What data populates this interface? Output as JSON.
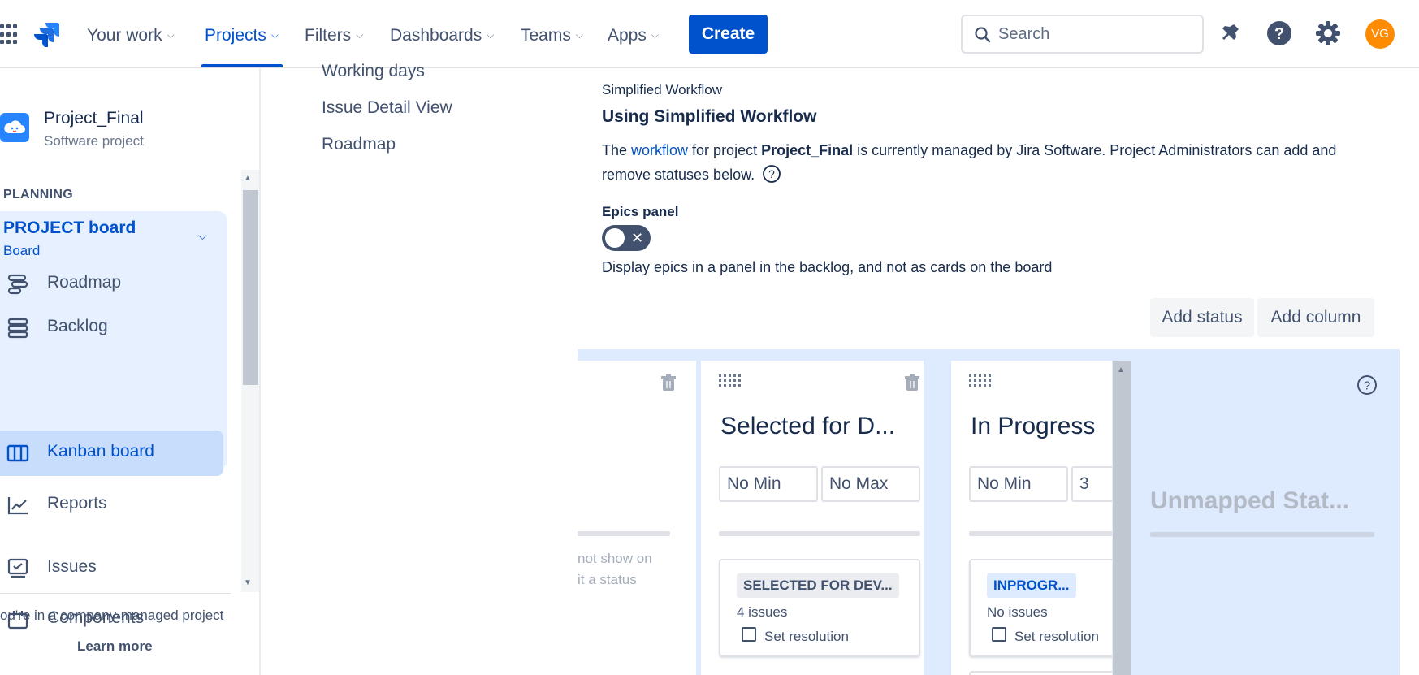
{
  "nav": {
    "items": [
      {
        "label": "Your work"
      },
      {
        "label": "Projects"
      },
      {
        "label": "Filters"
      },
      {
        "label": "Dashboards"
      },
      {
        "label": "Teams"
      },
      {
        "label": "Apps"
      }
    ],
    "create_label": "Create",
    "search_placeholder": "Search",
    "avatar_initials": "VG",
    "accent_color": "#0052cc"
  },
  "sidebar": {
    "project_name": "Project_Final",
    "project_type": "Software project",
    "planning_label": "PLANNING",
    "board_name": "PROJECT board",
    "board_sub": "Board",
    "items": [
      {
        "label": "Roadmap",
        "icon": "roadmap-icon"
      },
      {
        "label": "Backlog",
        "icon": "backlog-icon"
      },
      {
        "label": "Kanban board",
        "icon": "kanban-board-icon"
      },
      {
        "label": "Reports",
        "icon": "reports-icon"
      },
      {
        "label": "Issues",
        "icon": "issues-icon"
      },
      {
        "label": "Components",
        "icon": "components-icon"
      }
    ],
    "company_note": "ou're in a company-managed project",
    "learn_more": "Learn more"
  },
  "settings_nav": {
    "items": [
      {
        "label": "Working days"
      },
      {
        "label": "Issue Detail View"
      },
      {
        "label": "Roadmap"
      }
    ]
  },
  "main": {
    "workflow_section_label": "Simplified Workflow",
    "workflow_heading": "Using Simplified Workflow",
    "workflow_desc_prefix": "The ",
    "workflow_link": "workflow",
    "workflow_desc_mid": " for project ",
    "workflow_project": "Project_Final",
    "workflow_desc_suffix": " is currently managed by Jira Software. Project Administrators can add and remove statuses below.",
    "epics_label": "Epics panel",
    "epics_toggle_state": "off",
    "epics_desc": "Display epics in a panel in the backlog, and not as cards on the board",
    "add_status": "Add status",
    "add_column": "Add column"
  },
  "board": {
    "partial_column_text": [
      "not show on",
      "it a status"
    ],
    "columns": [
      {
        "title": "Selected for D...",
        "min": "No Min",
        "max": "No Max",
        "status": "SELECTED FOR DEV...",
        "status_color": "#42526e",
        "issues": "4 issues",
        "resolution_label": "Set resolution"
      },
      {
        "title": "In Progress",
        "min": "No Min",
        "max": "3",
        "status": "INPROGR...",
        "status_color": "#0052cc",
        "issues": "No issues",
        "resolution_label": "Set resolution"
      }
    ],
    "unmapped_title": "Unmapped Stat..."
  }
}
